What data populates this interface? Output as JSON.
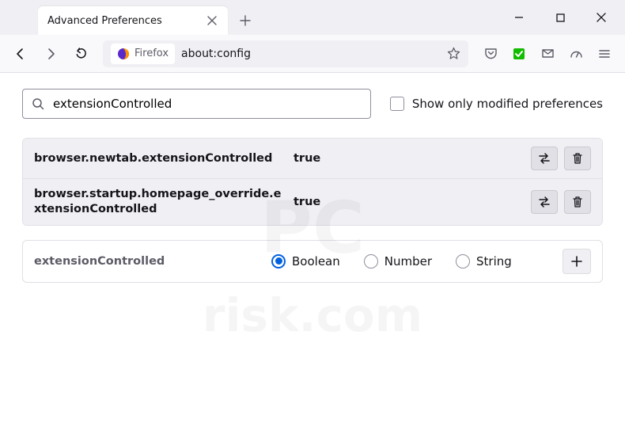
{
  "window": {
    "tab_title": "Advanced Preferences",
    "url": "about:config",
    "identity_label": "Firefox"
  },
  "page": {
    "search_value": "extensionControlled",
    "show_only_modified_label": "Show only modified preferences",
    "show_only_modified_checked": false
  },
  "prefs": [
    {
      "name": "browser.newtab.extensionControlled",
      "value": "true"
    },
    {
      "name": "browser.startup.homepage_override.extensionControlled",
      "value": "true"
    }
  ],
  "new_pref": {
    "name": "extensionControlled",
    "types": [
      "Boolean",
      "Number",
      "String"
    ],
    "selected": "Boolean"
  },
  "watermark": {
    "line1": "PC",
    "line2": "risk.com"
  }
}
